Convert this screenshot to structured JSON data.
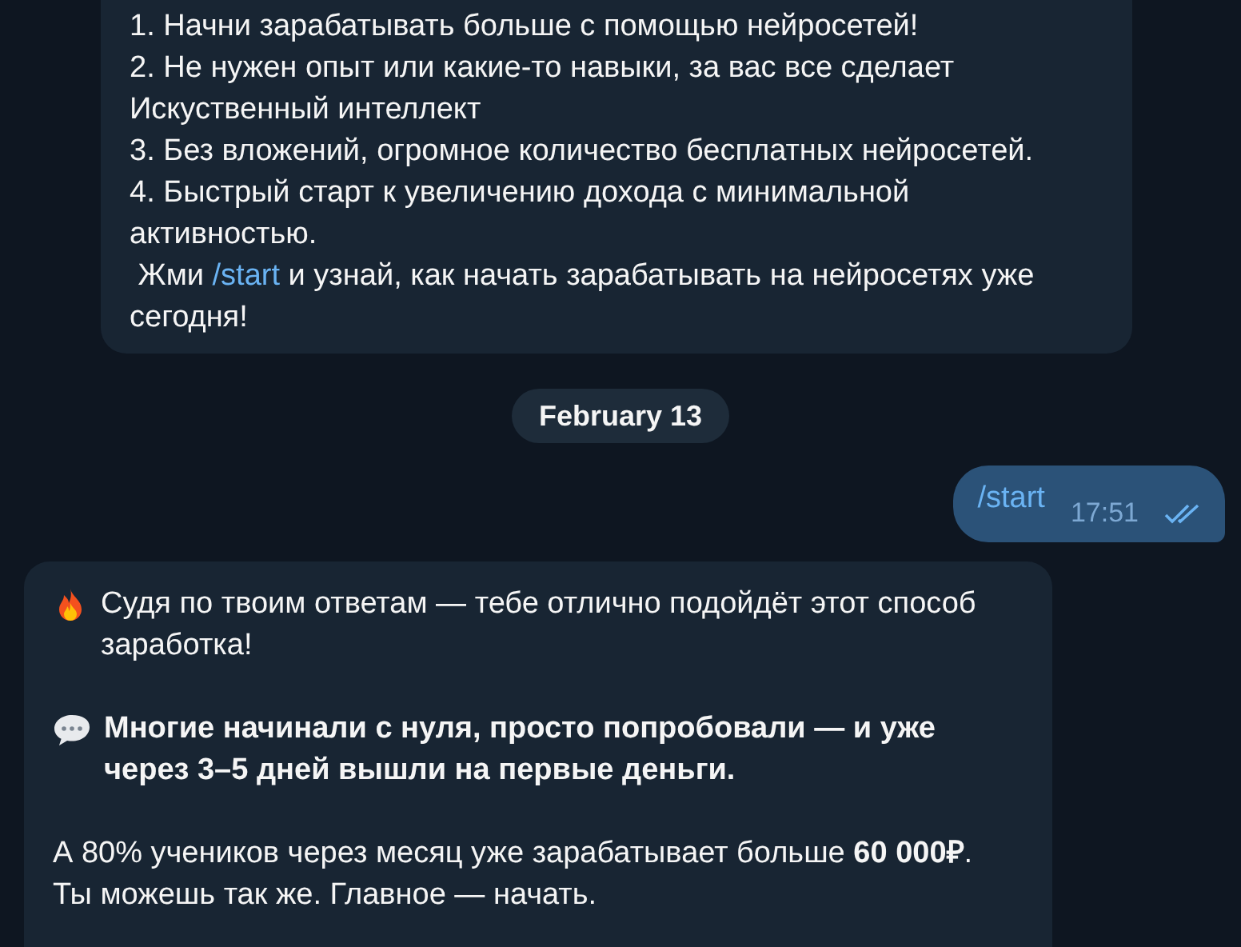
{
  "messages": [
    {
      "kind": "received",
      "paragraphs": [
        {
          "kind": "plain",
          "lines": [
            "1. Начни зарабатывать больше с помощью нейросетей!",
            "2. Не нужен опыт или какие-то навыки, за вас все сделает Искуственный интеллект",
            "3. Без вложений, огромное количество бесплатных нейросетей.",
            "4. Быстрый старт к увеличению дохода с минимальной активностью."
          ]
        },
        {
          "kind": "command",
          "before": " Жми ",
          "link": "/start",
          "after": " и узнай, как начать зарабатывать на нейросетях уже сегодня!"
        }
      ]
    },
    {
      "kind": "date",
      "text": "February 13"
    },
    {
      "kind": "sent",
      "text": "/start",
      "time": "17:51",
      "read": true
    },
    {
      "kind": "received",
      "paragraphs": [
        {
          "kind": "fire",
          "text": "Судя по твоим ответам — тебе отлично подойдёт этот способ заработка!"
        },
        {
          "kind": "speech",
          "text": "Многие начинали с нуля, просто попробовали — и уже через 3–5 дней вышли на первые деньги."
        },
        {
          "kind": "plain",
          "lines": [
            "А 80% учеников через месяц уже зарабатывает больше **60 000₽**.",
            "Ты можешь так же. Главное — начать."
          ]
        }
      ]
    }
  ]
}
